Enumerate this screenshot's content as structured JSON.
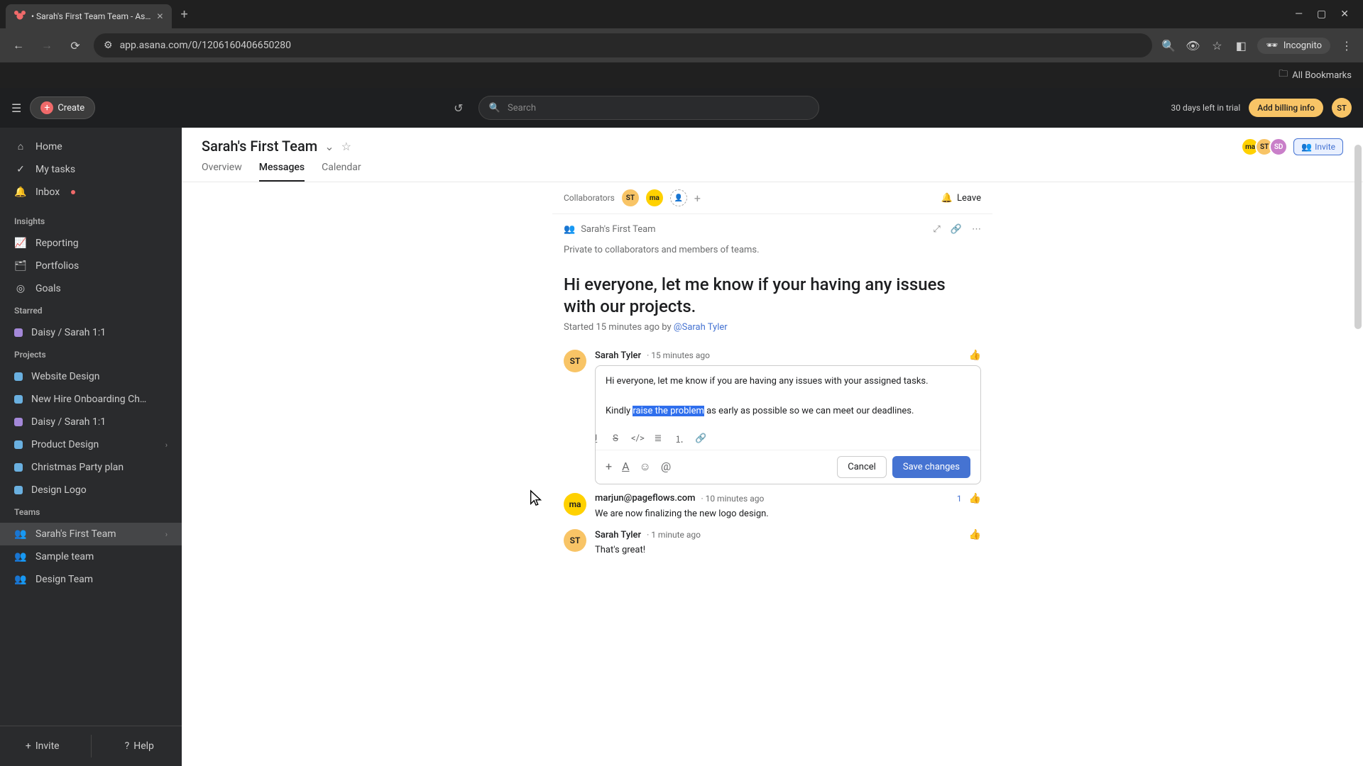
{
  "browser": {
    "tab_title": "• Sarah's First Team Team - As…",
    "url": "app.asana.com/0/1206160406650280",
    "incognito": "Incognito",
    "all_bookmarks": "All Bookmarks"
  },
  "topbar": {
    "create": "Create",
    "search_placeholder": "Search",
    "trial": "30 days left in trial",
    "billing": "Add billing info",
    "user_initials": "ST"
  },
  "sidebar": {
    "home": "Home",
    "my_tasks": "My tasks",
    "inbox": "Inbox",
    "insights": "Insights",
    "reporting": "Reporting",
    "portfolios": "Portfolios",
    "goals": "Goals",
    "starred": "Starred",
    "starred_items": [
      {
        "label": "Daisy / Sarah 1:1",
        "color": "#a488d9"
      }
    ],
    "projects": "Projects",
    "project_items": [
      {
        "label": "Website Design",
        "color": "#6ab0e0"
      },
      {
        "label": "New Hire Onboarding Ch…",
        "color": "#6ab0e0"
      },
      {
        "label": "Daisy / Sarah 1:1",
        "color": "#a488d9"
      },
      {
        "label": "Product Design",
        "color": "#6ab0e0"
      },
      {
        "label": "Christmas Party plan",
        "color": "#6ab0e0"
      },
      {
        "label": "Design Logo",
        "color": "#6ab0e0"
      }
    ],
    "teams": "Teams",
    "team_items": [
      {
        "label": "Sarah's First Team",
        "active": true
      },
      {
        "label": "Sample team",
        "active": false
      },
      {
        "label": "Design Team",
        "active": false
      }
    ],
    "invite": "Invite",
    "help": "Help"
  },
  "page": {
    "title": "Sarah's First Team",
    "tabs": {
      "overview": "Overview",
      "messages": "Messages",
      "calendar": "Calendar"
    },
    "invite_btn": "Invite"
  },
  "thread": {
    "collaborators_label": "Collaborators",
    "leave": "Leave",
    "team_name": "Sarah's First Team",
    "privacy": "Private to collaborators and members of teams.",
    "title": "Hi everyone, let me know if your having any issues with our projects.",
    "started_prefix": "Started 15 minutes ago by ",
    "started_by": "@Sarah Tyler"
  },
  "editor": {
    "author": "Sarah Tyler",
    "time": "· 15 minutes ago",
    "line1": "Hi everyone, let me know if you are having any issues with your assigned tasks.",
    "line2_pre": "Kindly ",
    "line2_hl": "raise the problem",
    "line2_post": " as early as possible so we can meet our deadlines.",
    "cancel": "Cancel",
    "save": "Save changes"
  },
  "comments": [
    {
      "avatar": "ma",
      "avatar_class": "ma",
      "author": "marjun@pageflows.com",
      "time": "· 10 minutes ago",
      "text": "We are now finalizing the new logo design.",
      "likes": "1",
      "liked": true
    },
    {
      "avatar": "ST",
      "avatar_class": "st",
      "author": "Sarah Tyler",
      "time": "· 1 minute ago",
      "text": "That's great!",
      "likes": "",
      "liked": false
    }
  ]
}
